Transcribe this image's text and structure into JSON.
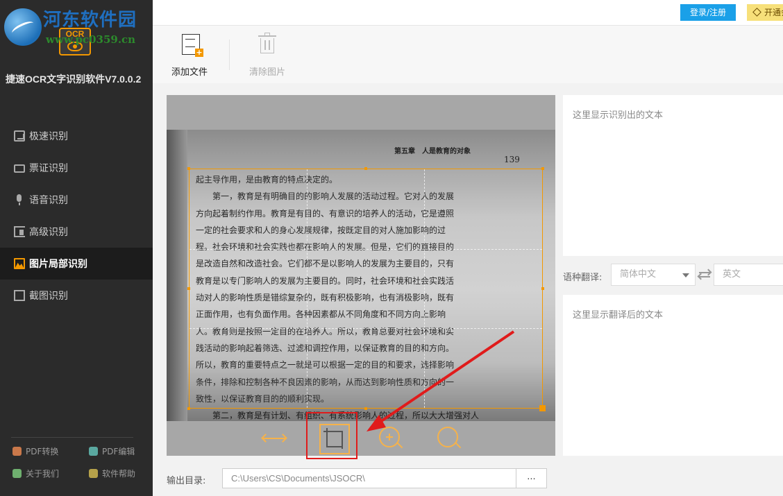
{
  "watermark": {
    "site_name": "河东软件园",
    "url": "www.pc0359.cn"
  },
  "logo": {
    "text": "OCR"
  },
  "app_title": "捷速OCR文字识别软件V7.0.0.2",
  "nav": {
    "items": [
      {
        "label": "极速识别",
        "icon": "quick-recognize-icon"
      },
      {
        "label": "票证识别",
        "icon": "ticket-icon"
      },
      {
        "label": "语音识别",
        "icon": "microphone-icon"
      },
      {
        "label": "高级识别",
        "icon": "advanced-icon"
      },
      {
        "label": "图片局部识别",
        "icon": "image-icon",
        "active": true
      },
      {
        "label": "截图识别",
        "icon": "screenshot-icon"
      }
    ]
  },
  "tools": {
    "pdf_convert": "PDF转换",
    "pdf_edit": "PDF编辑",
    "about": "关于我们",
    "help": "软件帮助"
  },
  "header": {
    "login": "登录/注册",
    "vip": "开通会员"
  },
  "toolbar": {
    "add_file": "添加文件",
    "clear_image": "清除图片"
  },
  "image": {
    "chapter_title": "第五章　人是教育的对象",
    "page_number": "139",
    "lines": [
      "起主导作用，是由教育的特点决定的。",
      "　　第一，教育是有明确目的的影响人发展的活动过程。它对人的发展",
      "方向起着制约作用。教育是有目的、有意识的培养人的活动，它是遵照",
      "一定的社会要求和人的身心发展规律，按既定目的对人施加影响的过",
      "程。社会环境和社会实践也都在影响人的发展。但是，它们的直接目的",
      "是改造自然和改造社会。它们都不是以影响人的发展为主要目的，只有",
      "教育是以专门影响人的发展为主要目的。同时，社会环境和社会实践活",
      "动对人的影响性质是错综复杂的，既有积极影响，也有消极影响，既有",
      "正面作用，也有负面作用。各种因素都从不同角度和不同方向上影响",
      "人。教育则是按照一定目的在培养人。所以，教育总要对社会环境和实",
      "践活动的影响起着筛选、过滤和调控作用，以保证教育的目的和方向。",
      "所以，教育的重要特点之一就是可以根据一定的目的和要求，选择影响",
      "条件，排除和控制各种不良因素的影响，从而达到影响性质和方向的一",
      "致性，以保证教育目的的顺利实现。",
      "　　第二，教育是有计划、有组织、有系统影响人的过程，所以大大增强对人"
    ]
  },
  "results": {
    "recognized_placeholder": "这里显示识别出的文本",
    "translated_placeholder": "这里显示翻译后的文本"
  },
  "translate": {
    "label": "语种翻译:",
    "source": "简体中文",
    "target": "英文"
  },
  "output": {
    "label": "输出目录:",
    "path": "C:\\Users\\CS\\Documents\\JSOCR\\",
    "browse": "..."
  },
  "colors": {
    "accent": "#f39800",
    "login": "#1aa0e8",
    "sidebar": "#2b2b2b",
    "annotation": "#e01b1b"
  }
}
